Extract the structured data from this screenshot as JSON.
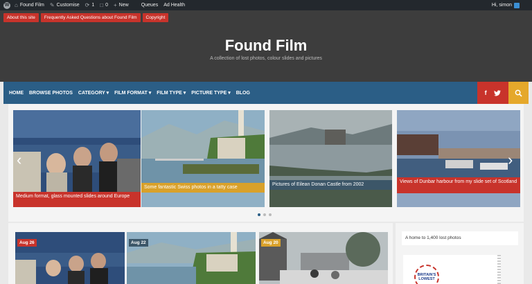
{
  "adminbar": {
    "site_name": "Found Film",
    "customise": "Customise",
    "updates_count": "1",
    "comments_count": "0",
    "new": "New",
    "queues": "Queues",
    "ad_health": "Ad Health",
    "greeting": "Hi, simon"
  },
  "header": {
    "top_links": [
      "About this site",
      "Frequently Asked Questions about Found Film",
      "Copyright"
    ],
    "title": "Found Film",
    "description": "A collection of lost photos, colour slides and pictures"
  },
  "nav": {
    "items": [
      "HOME",
      "BROWSE PHOTOS",
      "CATEGORY ▾",
      "FILM FORMAT ▾",
      "FILM TYPE ▾",
      "PICTURE TYPE ▾",
      "BLOG"
    ],
    "facebook": "f",
    "twitter": "🐦"
  },
  "slider": {
    "slides": [
      {
        "caption": "Medium format, glass mounted slides around Europe"
      },
      {
        "caption": "Some fantastic Swiss photos in a tatty case"
      },
      {
        "caption": "Pictures of Eilean Donan Castle from 2002"
      },
      {
        "caption": "Views of Dunbar harbour from my slide set of Scotland"
      }
    ],
    "prev": "‹",
    "next": "›"
  },
  "posts": [
    {
      "date": "Aug 26"
    },
    {
      "date": "Aug 22"
    },
    {
      "date": "Aug 20"
    }
  ],
  "sidebar": {
    "tagline": "A home to 1,400 lost photos",
    "ad_text": "BRITAIN'S LOWEST"
  },
  "colors": {
    "accent_red": "#c8332b",
    "nav_blue": "#2b5e86",
    "accent_gold": "#e5a82b"
  }
}
